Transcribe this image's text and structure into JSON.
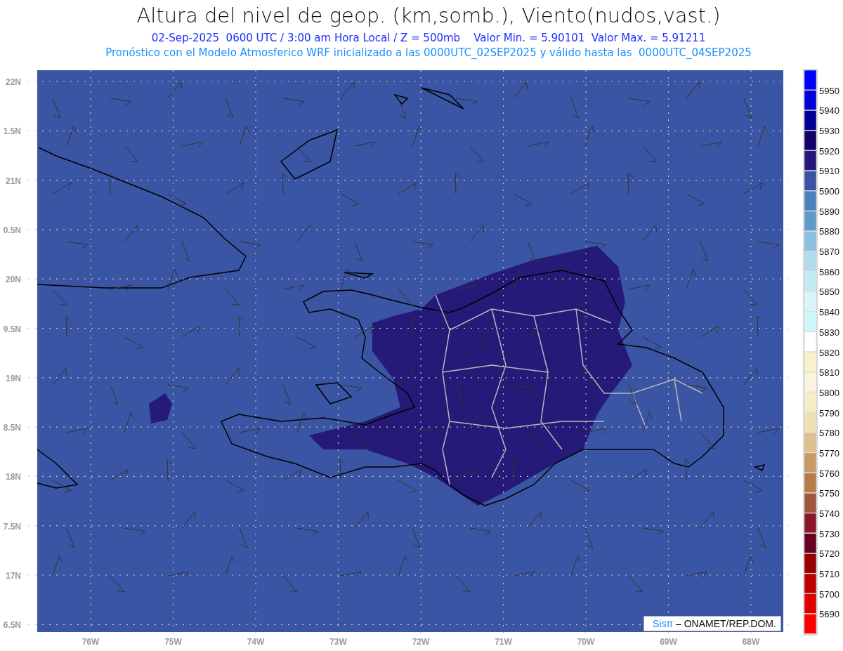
{
  "title": "Altura del nivel de geop. (km,somb.), Viento(nudos,vast.)",
  "subtitle": "02-Sep-2025  0600 UTC / 3:00 am Hora Local / Z = 500mb    Valor Min. = 5.90101  Valor Max. = 5.91211",
  "forecast_line": "Pronóstico con el Modelo Atmosferico WRF inicializado a las 0000UTC_02SEP2025 y válido hasta las  0000UTC_04SEP2025",
  "map": {
    "lat_labels": [
      "22N",
      "1.5N",
      "21N",
      "0.5N",
      "20N",
      "9.5N",
      "19N",
      "8.5N",
      "18N",
      "7.5N",
      "17N",
      "6.5N"
    ],
    "lon_labels": [
      "76W",
      "75W",
      "74W",
      "73W",
      "72W",
      "71W",
      "70W",
      "69W",
      "68W"
    ],
    "credit": {
      "brand": "Sisπ",
      "text": "– ONAMET/REP.DOM."
    }
  },
  "colorbar": {
    "segments": [
      {
        "color": "#0000ff"
      },
      {
        "color": "#0000d8"
      },
      {
        "color": "#000096"
      },
      {
        "color": "#140064"
      },
      {
        "color": "#26187a"
      },
      {
        "color": "#3a54a4"
      },
      {
        "color": "#4a82bc"
      },
      {
        "color": "#5f9acb"
      },
      {
        "color": "#8cc0e0"
      },
      {
        "color": "#b0dcec"
      },
      {
        "color": "#c4eaf2"
      },
      {
        "color": "#dcf4f8"
      },
      {
        "color": "#ccf8fa"
      },
      {
        "color": "#ffffff"
      },
      {
        "color": "#f8f2cc"
      },
      {
        "color": "#faf4e0"
      },
      {
        "color": "#f6eec4"
      },
      {
        "color": "#efe0b4"
      },
      {
        "color": "#dcc090"
      },
      {
        "color": "#c89a64"
      },
      {
        "color": "#b87c4c"
      },
      {
        "color": "#a0563c"
      },
      {
        "color": "#881828"
      },
      {
        "color": "#6c0020"
      },
      {
        "color": "#980000"
      },
      {
        "color": "#c00000"
      },
      {
        "color": "#e00000"
      },
      {
        "color": "#ff0000"
      }
    ],
    "labels": [
      "5950",
      "5940",
      "5930",
      "5920",
      "5910",
      "5900",
      "5890",
      "5880",
      "5870",
      "5860",
      "5850",
      "5840",
      "5830",
      "5820",
      "5810",
      "5800",
      "5790",
      "5780",
      "5770",
      "5760",
      "5750",
      "5740",
      "5730",
      "5720",
      "5710",
      "5700",
      "5690"
    ]
  }
}
